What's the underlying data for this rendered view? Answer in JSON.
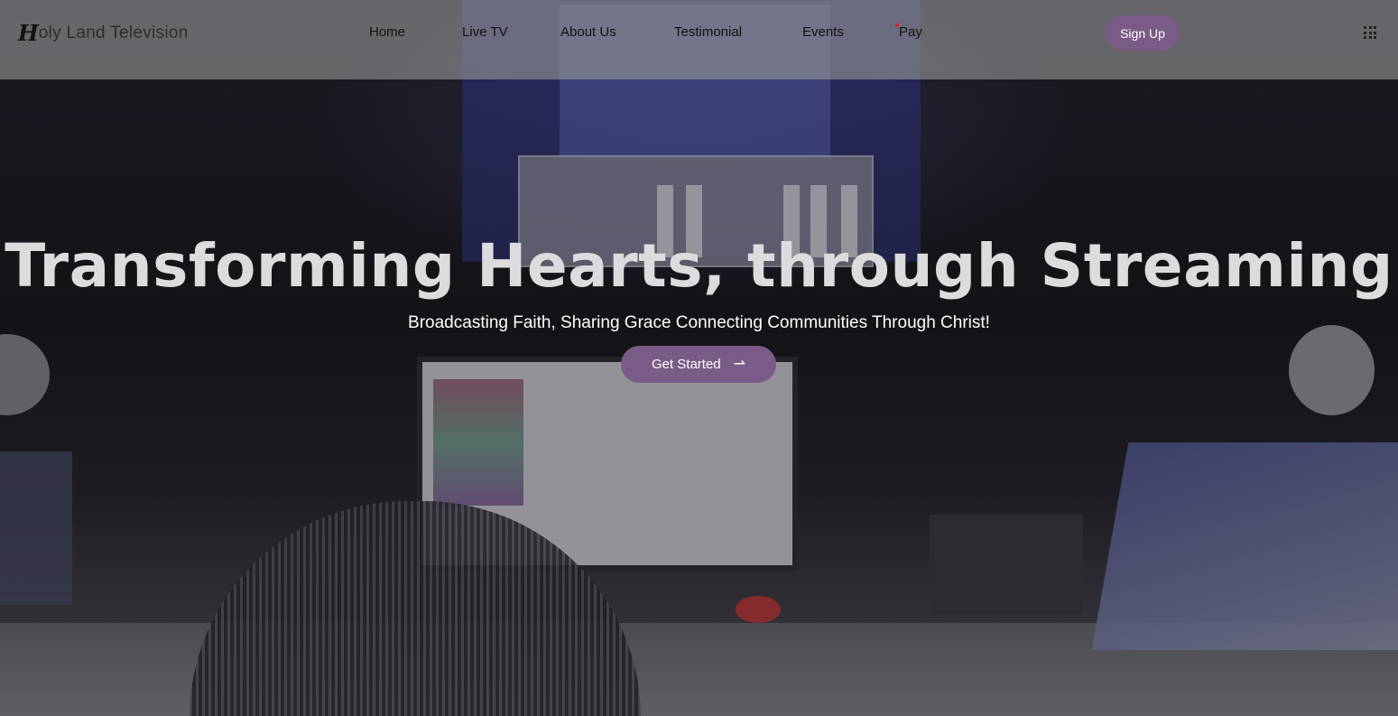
{
  "brand": {
    "logo_mark": "H",
    "name": "oly Land Television"
  },
  "nav": {
    "items": [
      {
        "label": "Home"
      },
      {
        "label": "Live TV"
      },
      {
        "label": "About Us"
      },
      {
        "label": "Testimonial"
      },
      {
        "label": "Events"
      },
      {
        "label": "Pay"
      }
    ],
    "signup_label": "Sign Up"
  },
  "hero": {
    "title": "Transforming Hearts, through Streaming",
    "subtitle": "Broadcasting Faith, Sharing Grace Connecting Communities Through Christ!",
    "cta_label": "Get Started",
    "cta_icon": "arrow-right-icon"
  },
  "colors": {
    "accent": "#7a5b87",
    "header_bg": "#969698",
    "notification_dot": "#e0201a"
  }
}
